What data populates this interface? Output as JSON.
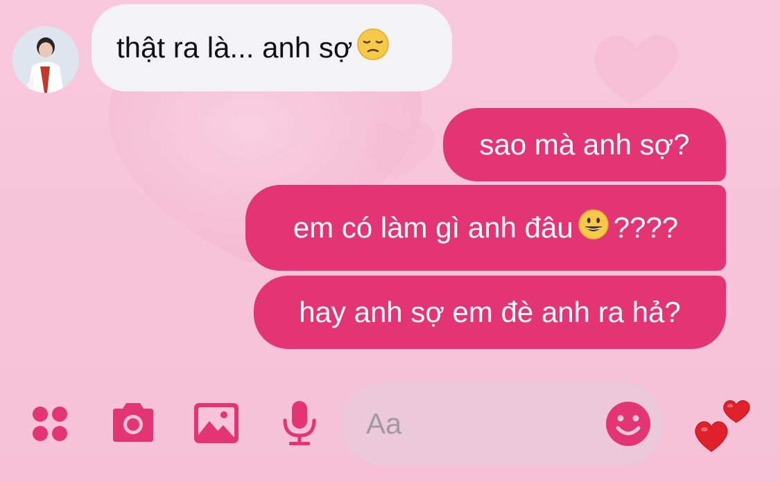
{
  "conversation": {
    "messages": [
      {
        "direction": "incoming",
        "text": "thật ra là... anh sợ",
        "emoji": "pensive-face"
      },
      {
        "direction": "outgoing",
        "text": "sao mà anh sợ?"
      },
      {
        "direction": "outgoing",
        "text_before_emoji": "em có làm gì anh đâu",
        "emoji": "grinning-face",
        "text_after_emoji": "????"
      },
      {
        "direction": "outgoing",
        "text": "hay anh sợ em đè anh ra hả?"
      }
    ]
  },
  "composer": {
    "placeholder": "Aa",
    "value": ""
  },
  "toolbar": {
    "icons": [
      "menu-dots-icon",
      "camera-icon",
      "image-icon",
      "microphone-icon",
      "emoji-icon",
      "double-heart-icon"
    ]
  },
  "colors": {
    "accent": "#e33574",
    "outgoing_bubble": "#e33574",
    "incoming_bubble": "#f3f2f4",
    "background": "#f7c4d9",
    "composer_bg": "#ecc9da"
  }
}
